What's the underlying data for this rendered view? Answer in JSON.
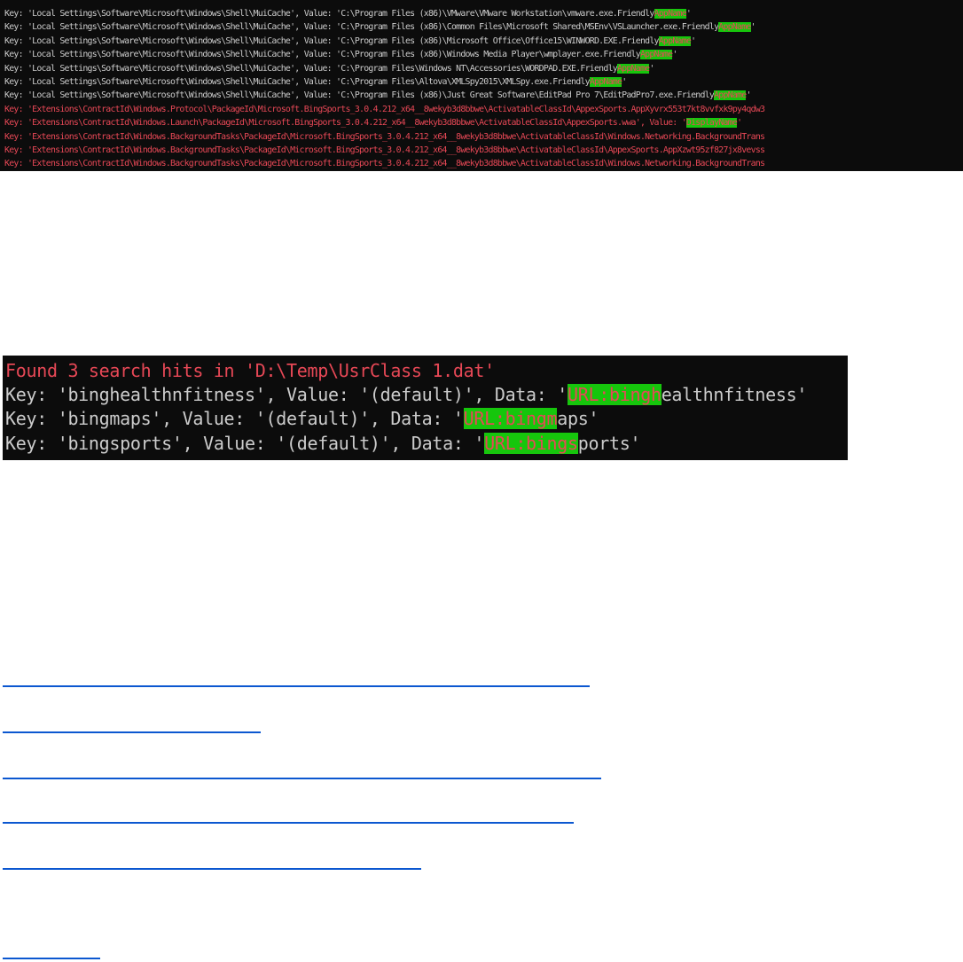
{
  "terminal_top": {
    "lines": [
      {
        "pre": "",
        "hl": "",
        "post": "",
        "red": false
      },
      {
        "pre": "Key: 'Local Settings\\Software\\Microsoft\\Windows\\Shell\\MuiCache', Value: 'C:\\Program Files (x86)\\VMware\\VMware Workstation\\vmware.exe.Friendly",
        "hl": "AppName",
        "post": "'",
        "red": false
      },
      {
        "pre": "Key: 'Local Settings\\Software\\Microsoft\\Windows\\Shell\\MuiCache', Value: 'C:\\Program Files (x86)\\Common Files\\Microsoft Shared\\MSEnv\\VSLauncher.exe.Friendly",
        "hl": "AppName",
        "post": "'",
        "red": false
      },
      {
        "pre": "Key: 'Local Settings\\Software\\Microsoft\\Windows\\Shell\\MuiCache', Value: 'C:\\Program Files (x86)\\Microsoft Office\\Office15\\WINWORD.EXE.Friendly",
        "hl": "AppName",
        "post": "'",
        "red": false
      },
      {
        "pre": "Key: 'Local Settings\\Software\\Microsoft\\Windows\\Shell\\MuiCache', Value: 'C:\\Program Files (x86)\\Windows Media Player\\wmplayer.exe.Friendly",
        "hl": "AppName",
        "post": "'",
        "red": false
      },
      {
        "pre": "Key: 'Local Settings\\Software\\Microsoft\\Windows\\Shell\\MuiCache', Value: 'C:\\Program Files\\Windows NT\\Accessories\\WORDPAD.EXE.Friendly",
        "hl": "AppName",
        "post": "'",
        "red": false
      },
      {
        "pre": "Key: 'Local Settings\\Software\\Microsoft\\Windows\\Shell\\MuiCache', Value: 'C:\\Program Files\\Altova\\XMLSpy2015\\XMLSpy.exe.Friendly",
        "hl": "AppName",
        "post": "'",
        "red": false
      },
      {
        "pre": "Key: 'Local Settings\\Software\\Microsoft\\Windows\\Shell\\MuiCache', Value: 'C:\\Program Files (x86)\\Just Great Software\\EditPad Pro 7\\EditPadPro7.exe.Friendly",
        "hl": "AppName",
        "post": "'",
        "red": false
      },
      {
        "pre": "Key: 'Extensions\\ContractId\\Windows.Protocol\\PackageId\\Microsoft.BingSports_3.0.4.212_x64__8wekyb3d8bbwe\\ActivatableClassId\\AppexSports.AppXyvrx553t7kt8vvfxk9py4qdw3",
        "hl": "",
        "post": "",
        "red": true
      },
      {
        "pre": "Key: 'Extensions\\ContractId\\Windows.Launch\\PackageId\\Microsoft.BingSports_3.0.4.212_x64__8wekyb3d8bbwe\\ActivatableClassId\\AppexSports.wwa', Value: '",
        "hl": "DisplayName",
        "post": "'",
        "red": true
      },
      {
        "pre": "Key: 'Extensions\\ContractId\\Windows.BackgroundTasks\\PackageId\\Microsoft.BingSports_3.0.4.212_x64__8wekyb3d8bbwe\\ActivatableClassId\\Windows.Networking.BackgroundTrans",
        "hl": "",
        "post": "",
        "red": true
      },
      {
        "pre": "Key: 'Extensions\\ContractId\\Windows.BackgroundTasks\\PackageId\\Microsoft.BingSports_3.0.4.212_x64__8wekyb3d8bbwe\\ActivatableClassId\\AppexSports.AppXzwt95zf827jx8vevss",
        "hl": "",
        "post": "",
        "red": true
      },
      {
        "pre": "Key: 'Extensions\\ContractId\\Windows.BackgroundTasks\\PackageId\\Microsoft.BingSports_3.0.4.212_x64__8wekyb3d8bbwe\\ActivatableClassId\\Windows.Networking.BackgroundTrans",
        "hl": "",
        "post": "",
        "red": true
      },
      {
        "pre": "Key: 'Extensions\\ContractId\\Windows.BackgroundTasks\\PackageId\\Microsoft.BingSports_3.0.4.212_x64__8wekyb3d8bbwe\\ActivatableClassId\\Windows.Networking.ContentPrefetch",
        "hl": "",
        "post": "",
        "red": true
      }
    ]
  },
  "terminal_search": {
    "header": "Found 3 search hits in 'D:\\Temp\\UsrClass 1.dat'",
    "lines": [
      {
        "pre": "Key: 'binghealthnfitness', Value: '(default)', Data: '",
        "hl": "URL:bingh",
        "post": "ealthnfitness'"
      },
      {
        "pre": "Key: 'bingmaps', Value: '(default)', Data: '",
        "hl": "URL:bingm",
        "post": "aps'"
      },
      {
        "pre": "Key: 'bingsports', Value: '(default)', Data: '",
        "hl": "URL:bings",
        "post": "ports'"
      }
    ]
  },
  "colors": {
    "terminal_bg": "#0c0c0c",
    "terminal_text": "#cccccc",
    "error_red": "#e74856",
    "highlight_green": "#16c60c",
    "link_blue": "#0b57d0"
  }
}
